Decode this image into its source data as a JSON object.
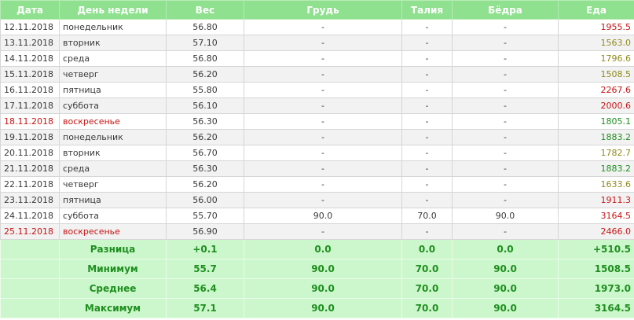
{
  "headers": {
    "date": "Дата",
    "day": "День недели",
    "weight": "Вес",
    "chest": "Грудь",
    "waist": "Талия",
    "hips": "Бёдра",
    "food": "Еда"
  },
  "rows": [
    {
      "date": "12.11.2018",
      "day": "понедельник",
      "weight": "56.80",
      "chest": "-",
      "waist": "-",
      "hips": "-",
      "food": "1955.5",
      "food_level": "red",
      "weekend": false
    },
    {
      "date": "13.11.2018",
      "day": "вторник",
      "weight": "57.10",
      "chest": "-",
      "waist": "-",
      "hips": "-",
      "food": "1563.0",
      "food_level": "olive",
      "weekend": false
    },
    {
      "date": "14.11.2018",
      "day": "среда",
      "weight": "56.80",
      "chest": "-",
      "waist": "-",
      "hips": "-",
      "food": "1796.6",
      "food_level": "olive",
      "weekend": false
    },
    {
      "date": "15.11.2018",
      "day": "четверг",
      "weight": "56.20",
      "chest": "-",
      "waist": "-",
      "hips": "-",
      "food": "1508.5",
      "food_level": "olive",
      "weekend": false
    },
    {
      "date": "16.11.2018",
      "day": "пятница",
      "weight": "55.80",
      "chest": "-",
      "waist": "-",
      "hips": "-",
      "food": "2267.6",
      "food_level": "red",
      "weekend": false
    },
    {
      "date": "17.11.2018",
      "day": "суббота",
      "weight": "56.10",
      "chest": "-",
      "waist": "-",
      "hips": "-",
      "food": "2000.6",
      "food_level": "red",
      "weekend": false
    },
    {
      "date": "18.11.2018",
      "day": "воскресенье",
      "weight": "56.30",
      "chest": "-",
      "waist": "-",
      "hips": "-",
      "food": "1805.1",
      "food_level": "green",
      "weekend": true
    },
    {
      "date": "19.11.2018",
      "day": "понедельник",
      "weight": "56.20",
      "chest": "-",
      "waist": "-",
      "hips": "-",
      "food": "1883.2",
      "food_level": "green",
      "weekend": false
    },
    {
      "date": "20.11.2018",
      "day": "вторник",
      "weight": "56.70",
      "chest": "-",
      "waist": "-",
      "hips": "-",
      "food": "1782.7",
      "food_level": "olive",
      "weekend": false
    },
    {
      "date": "21.11.2018",
      "day": "среда",
      "weight": "56.30",
      "chest": "-",
      "waist": "-",
      "hips": "-",
      "food": "1883.2",
      "food_level": "green",
      "weekend": false
    },
    {
      "date": "22.11.2018",
      "day": "четверг",
      "weight": "56.20",
      "chest": "-",
      "waist": "-",
      "hips": "-",
      "food": "1633.6",
      "food_level": "olive",
      "weekend": false
    },
    {
      "date": "23.11.2018",
      "day": "пятница",
      "weight": "56.00",
      "chest": "-",
      "waist": "-",
      "hips": "-",
      "food": "1911.3",
      "food_level": "red",
      "weekend": false
    },
    {
      "date": "24.11.2018",
      "day": "суббота",
      "weight": "55.70",
      "chest": "90.0",
      "waist": "70.0",
      "hips": "90.0",
      "food": "3164.5",
      "food_level": "red",
      "weekend": false
    },
    {
      "date": "25.11.2018",
      "day": "воскресенье",
      "weight": "56.90",
      "chest": "-",
      "waist": "-",
      "hips": "-",
      "food": "2466.0",
      "food_level": "red",
      "weekend": true
    }
  ],
  "summary": [
    {
      "label": "Разница",
      "weight": "+0.1",
      "chest": "0.0",
      "waist": "0.0",
      "hips": "0.0",
      "food": "+510.5"
    },
    {
      "label": "Минимум",
      "weight": "55.7",
      "chest": "90.0",
      "waist": "70.0",
      "hips": "90.0",
      "food": "1508.5"
    },
    {
      "label": "Среднее",
      "weight": "56.4",
      "chest": "90.0",
      "waist": "70.0",
      "hips": "90.0",
      "food": "1973.0"
    },
    {
      "label": "Максимум",
      "weight": "57.1",
      "chest": "90.0",
      "waist": "70.0",
      "hips": "90.0",
      "food": "3164.5"
    }
  ],
  "colors": {
    "header_bg": "#8fe08f",
    "summary_bg": "#ccf7cc",
    "weekend_text": "#c81414",
    "food_red": "#c81414",
    "food_olive": "#8f8a1c",
    "food_green": "#1f8f1f"
  }
}
